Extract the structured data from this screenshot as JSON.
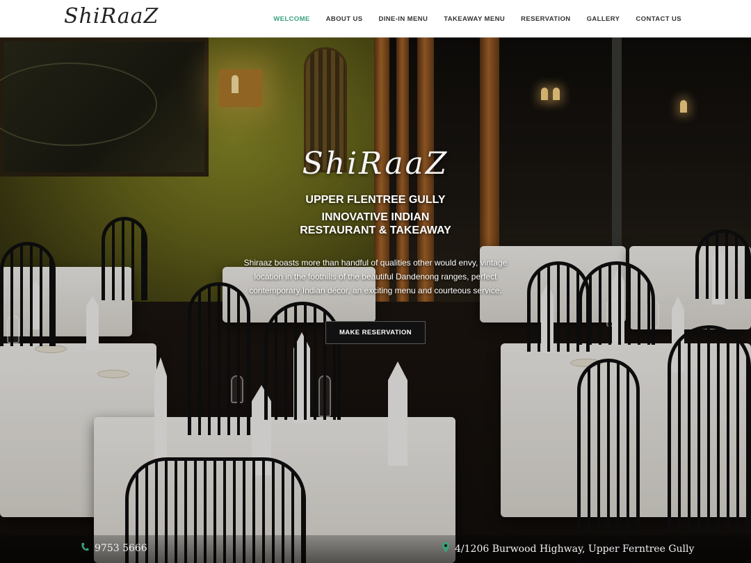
{
  "header": {
    "logo_text": "ShiRaaZ",
    "nav": [
      {
        "label": "WELCOME",
        "active": true
      },
      {
        "label": "ABOUT US"
      },
      {
        "label": "DINE-IN MENU"
      },
      {
        "label": "TAKEAWAY MENU"
      },
      {
        "label": "RESERVATION"
      },
      {
        "label": "GALLERY"
      },
      {
        "label": "CONTACT US"
      }
    ]
  },
  "hero": {
    "logo_text": "ShiRaaZ",
    "subtitle": "UPPER FLENTREE GULLY",
    "heading_line1": "INNOVATIVE INDIAN",
    "heading_line2": "RESTAURANT & TAKEAWAY",
    "description": "Shiraaz boasts more than handful of qualities other would envy, vintage location in the foothills of the beautiful Dandenong ranges, perfect contemporary Indian décor, an exciting menu and courteous service.",
    "cta_label": "MAKE RESERVATION"
  },
  "contact": {
    "phone_icon": "phone-icon",
    "phone": "9753 5666",
    "address_icon": "map-pin-icon",
    "address": "4/1206 Burwood Highway, Upper Ferntree Gully"
  },
  "colors": {
    "accent": "#3aa27b",
    "nav_text": "#333333",
    "button_bg": "#111111"
  }
}
